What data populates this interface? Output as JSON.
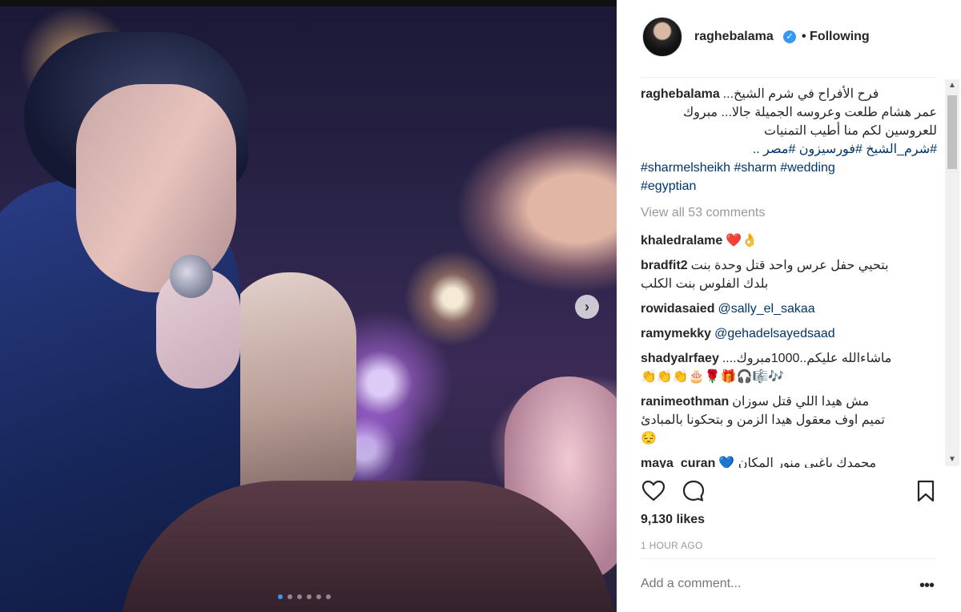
{
  "post": {
    "username": "raghebalama",
    "follow_status": "• Following",
    "verified_icon": "verified-badge-icon",
    "likes": "9,130 likes",
    "time": "1 HOUR AGO",
    "add_comment_placeholder": "Add a comment...",
    "more_label": "•••",
    "carousel": {
      "slide_count": 6,
      "active_index": 0,
      "next_label": "›"
    }
  },
  "caption": {
    "username": "raghebalama",
    "line1": "فرح الأفراح في شرم الشيخ...",
    "line2": "عمر هشام طلعت وعروسه الجميلة جالا... مبروك",
    "line3": "للعروسين لكم منا أطيب التمنيات",
    "ar_tags": "#شرم_الشيخ  #فورسيزون #مصر ..",
    "tags_line1": "#sharmelsheikh #sharm #wedding",
    "tags_line2": "#egyptian"
  },
  "view_all": "View all 53 comments",
  "comments": [
    {
      "user": "khaledralame",
      "text": "❤️👌"
    },
    {
      "user": "bradfit2",
      "text": "بتحيي حفل عرس واحد قتل وحدة بنت",
      "text2": "بلدك الفلوس بنت الكلب"
    },
    {
      "user": "rowidasaied",
      "text": "@sally_el_sakaa"
    },
    {
      "user": "ramymekky",
      "text": "@gehadelsayedsaad"
    },
    {
      "user": "shadyalrfaey",
      "text": "....ماشاءالله عليكم..1000مبروك",
      "text2": "👏👏👏🎂🌹🎁🎧🎼🎶"
    },
    {
      "user": "ranimeothman",
      "text": "مش هيدا اللي قتل سوزان",
      "text2": "تميم اوف معقول هيدا الزمن و بتحكونا بالمبادئ",
      "text3": "😔"
    },
    {
      "user": "maya_curan",
      "text": "محمدك باغبي منور المكان 💙"
    }
  ]
}
